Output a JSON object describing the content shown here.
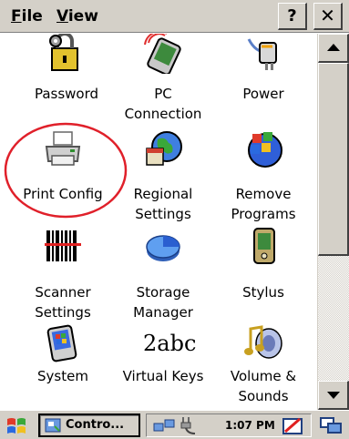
{
  "menu": {
    "file": "File",
    "view": "View"
  },
  "toolbar": {
    "help_label": "?",
    "close_label": "✕"
  },
  "items": [
    {
      "label_1": "Password",
      "label_2": "",
      "icon": "password-lock-icon"
    },
    {
      "label_1": "PC",
      "label_2": "Connection",
      "icon": "pc-connection-icon"
    },
    {
      "label_1": "Power",
      "label_2": "",
      "icon": "power-plug-icon"
    },
    {
      "label_1": "Print Config",
      "label_2": "",
      "icon": "printer-icon"
    },
    {
      "label_1": "Regional",
      "label_2": "Settings",
      "icon": "globe-calendar-icon"
    },
    {
      "label_1": "Remove",
      "label_2": "Programs",
      "icon": "windows-globe-icon"
    },
    {
      "label_1": "Scanner",
      "label_2": "Settings",
      "icon": "barcode-icon"
    },
    {
      "label_1": "Storage",
      "label_2": "Manager",
      "icon": "pie-chart-icon"
    },
    {
      "label_1": "Stylus",
      "label_2": "",
      "icon": "handheld-device-icon"
    },
    {
      "label_1": "System",
      "label_2": "",
      "icon": "system-device-icon"
    },
    {
      "label_1": "Virtual Keys",
      "label_2": "",
      "icon": "2abc-icon",
      "icon_text": "2abc"
    },
    {
      "label_1": "Volume &",
      "label_2": "Sounds",
      "icon": "music-note-speaker-icon"
    }
  ],
  "taskbar": {
    "task_label": "Contro...",
    "clock": "1:07 PM"
  },
  "colors": {
    "annotation": "#e0202a",
    "chrome": "#d4d0c8"
  }
}
